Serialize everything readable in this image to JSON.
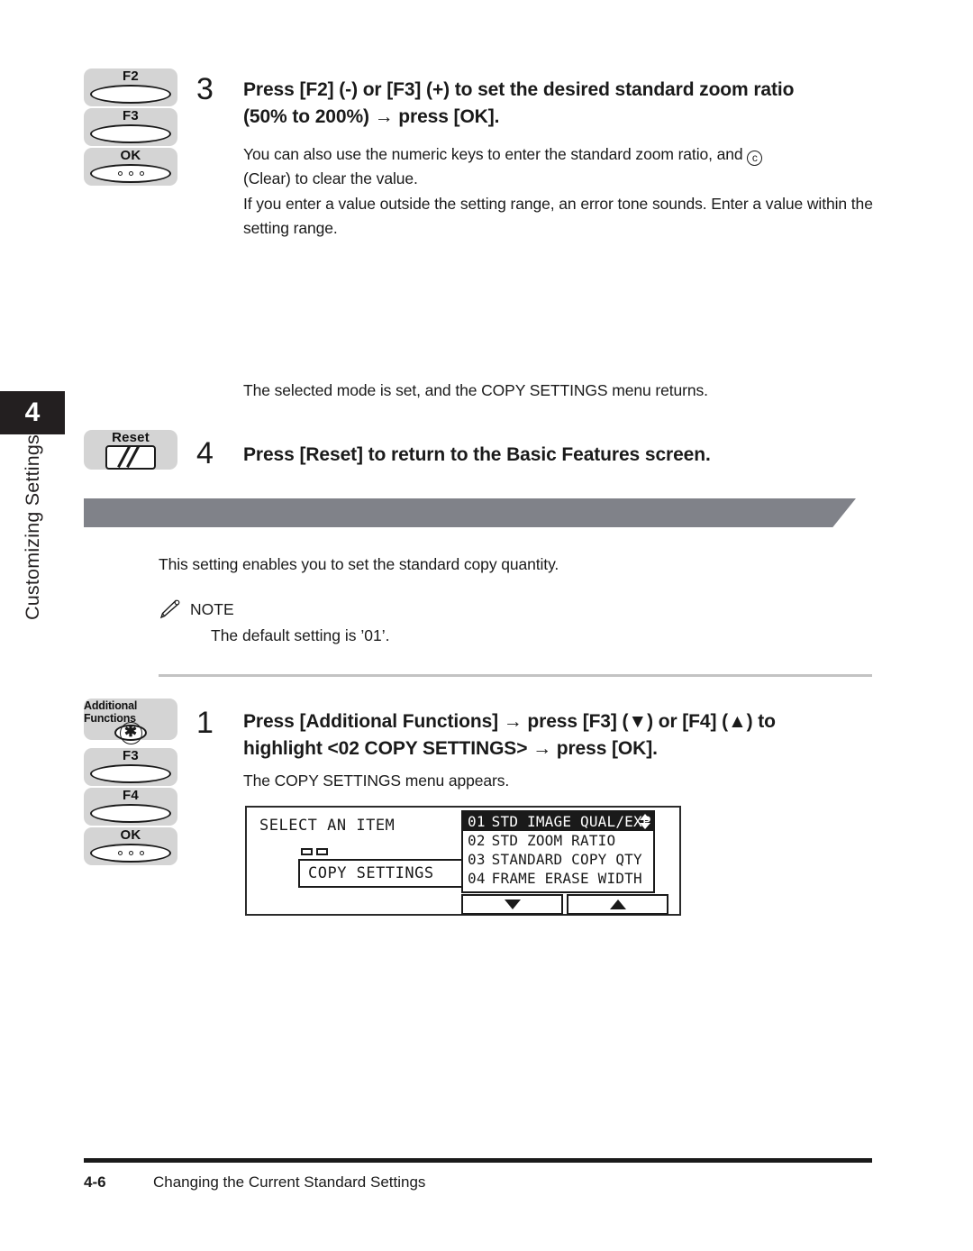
{
  "chapter": {
    "number": "4",
    "title": "Customizing Settings"
  },
  "steps": [
    {
      "number": "3",
      "heading_line1": "Press [F2] (-) or [F3] (+) to set the desired standard zoom ratio",
      "heading_line2": "(50% to 200%) → press [OK].",
      "para1_before": "You can also use the numeric keys to enter the standard zoom ratio, and",
      "para1_c_glyph": "c",
      "para1_after": "(Clear) to clear the value.",
      "para2": "If you enter a value outside the setting range, an error tone sounds. Enter a value within the setting range.",
      "keys": [
        {
          "label": "F2",
          "glyph": "oval-key"
        },
        {
          "label": "F3",
          "glyph": "oval-key"
        },
        {
          "label": "OK",
          "glyph": "oval-key-dots"
        }
      ]
    },
    {
      "number": "4",
      "result_text": "The selected mode is set, and the COPY SETTINGS menu returns.",
      "heading": "Press [Reset] to return to the Basic Features screen.",
      "keys": [
        {
          "label": "Reset",
          "glyph": "reset-key"
        }
      ]
    }
  ],
  "section": {
    "banner_label": "",
    "intro": "This setting enables you to set the standard copy quantity.",
    "note_label": "NOTE",
    "note_body": "The default setting is ’01’."
  },
  "procedure": {
    "number": "1",
    "heading_line1": "Press [Additional Functions] → press [F3] (▼) or [F4] (▲) to",
    "heading_line2": "highlight <02 COPY SETTINGS> → press [OK].",
    "result_text": "The COPY SETTINGS menu appears.",
    "keys": [
      {
        "label": "Additional Functions",
        "glyph": "af-key"
      },
      {
        "label": "F3",
        "glyph": "oval-key"
      },
      {
        "label": "F4",
        "glyph": "oval-key"
      },
      {
        "label": "OK",
        "glyph": "oval-key-dots"
      }
    ]
  },
  "lcd": {
    "title": "SELECT AN ITEM",
    "subbox_label": "COPY SETTINGS",
    "items": [
      {
        "index": "01",
        "label": "STD IMAGE QUAL/EXP",
        "selected": true
      },
      {
        "index": "02",
        "label": "STD ZOOM RATIO",
        "selected": false
      },
      {
        "index": "03",
        "label": "STANDARD COPY QTY",
        "selected": false
      },
      {
        "index": "04",
        "label": "FRAME ERASE WIDTH",
        "selected": false
      }
    ],
    "scroll_down_label": "▼",
    "scroll_up_label": "▲"
  },
  "footer": {
    "page_number": "4-6",
    "running_title": "Changing the Current Standard Settings"
  },
  "colors": {
    "banner": "#808289",
    "chapter_tab": "#231f20",
    "keycap": "#d4d4d4",
    "rule": "#c3c3c3"
  }
}
